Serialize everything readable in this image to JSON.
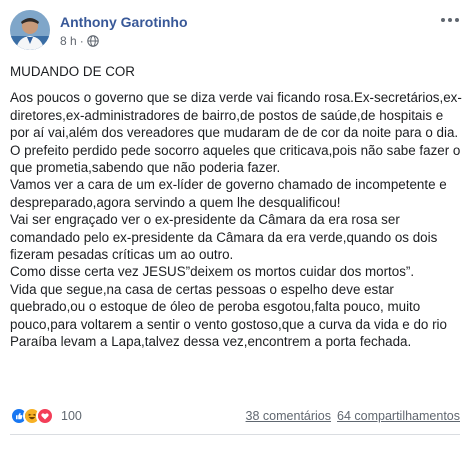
{
  "post": {
    "author": "Anthony Garotinho",
    "time": "8 h",
    "separator": "·",
    "privacy_icon": "globe-icon",
    "title": "MUDANDO DE COR",
    "paragraphs": [
      "Aos poucos o governo que se diza verde vai ficando rosa.Ex-secretários,ex-diretores,ex-administradores de bairro,de postos de saúde,de hospitais e por aí vai,além dos vereadores que mudaram de de cor da noite para o dia.",
      "O prefeito perdido pede socorro aqueles que criticava,pois não sabe fazer o que prometia,sabendo que não poderia fazer.",
      "Vamos ver a cara de um ex-líder de governo chamado de incompetente e despreparado,agora servindo a quem lhe desqualificou!",
      "Vai ser engraçado ver o ex-presidente da Câmara da era rosa ser comandado pelo ex-presidente da Câmara da era verde,quando os dois fizeram pesadas críticas um ao outro.",
      "Como disse certa vez JESUS”deixem os mortos cuidar dos mortos”.",
      "Vida que segue,na casa de certas pessoas o espelho deve estar quebrado,ou o estoque de óleo de peroba esgotou,falta pouco, muito pouco,para voltarem a sentir o vento gostoso,que a curva da vida e do rio Paraíba levam a Lapa,talvez dessa vez,encontrem a porta fechada."
    ]
  },
  "stats": {
    "reactions": [
      "like-icon",
      "haha-icon",
      "love-icon"
    ],
    "reaction_count": "100",
    "comments": "38 comentários",
    "shares": "64 compartilhamentos"
  },
  "colors": {
    "link": "#385898",
    "text": "#1c1e21",
    "meta": "#606770",
    "like": "#1877f2",
    "haha": "#f7b125",
    "love": "#f33e58"
  }
}
